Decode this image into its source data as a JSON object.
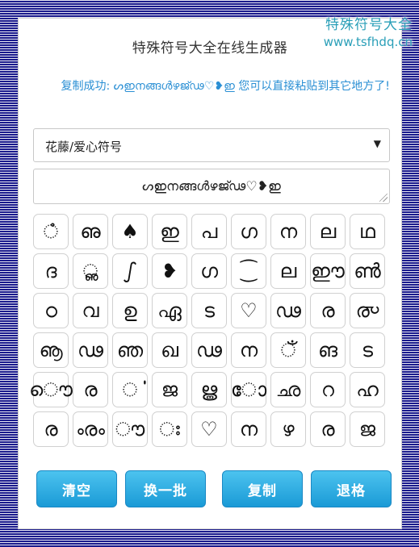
{
  "watermark": {
    "title": "特殊符号大全",
    "url": "www.tsfhdq.cn"
  },
  "page_title": "特殊符号大全在线生成器",
  "status": {
    "prefix": "复制成功:",
    "symbols": "ᔕഇനങ്ങൾഴജ്ഢ♡❥ഇ",
    "suffix": "您可以直接粘贴到其它地方了!"
  },
  "category_select": {
    "value": "花藤/爱心符号"
  },
  "output": {
    "value": "ᔕഇനങ്ങൾഴജ്ഢ♡❥ഇ"
  },
  "symbols": [
    "ഀ",
    "ഌ",
    "♠",
    "ഇ",
    "പ",
    "ഗ",
    "ന",
    "ല",
    "ഥ",
    "ദ",
    "ൢ",
    "ഽ",
    "❥",
    "ഗ",
    "⁐",
    "ല",
    "ഈ",
    "ൺ",
    "ഠ",
    "വ",
    "ഉ",
    "ഏ",
    "ട",
    "♡",
    "ഢ",
    "ര",
    "൞",
    "ൡ",
    "ഢ",
    "ഞ",
    "ഖ",
    "ഢ",
    "ന",
    "ഁ",
    "ങ",
    "ട",
    "ൌ",
    "ര",
    "ൎ",
    "ജ",
    "ൠ",
    "ോ",
    "ഛ",
    "റ",
    "ഹ",
    "ര",
    "ൟ",
    "ൗ",
    "ഃ",
    "♡",
    "ന",
    "ഴ",
    "ര",
    "ജ"
  ],
  "buttons": {
    "clear": "清空",
    "change": "换一批",
    "copy": "复制",
    "backspace": "退格"
  },
  "colors": {
    "button_blue": "#1a9ad6",
    "status_blue": "#2a8fd4",
    "border": "#1a1a8c"
  }
}
